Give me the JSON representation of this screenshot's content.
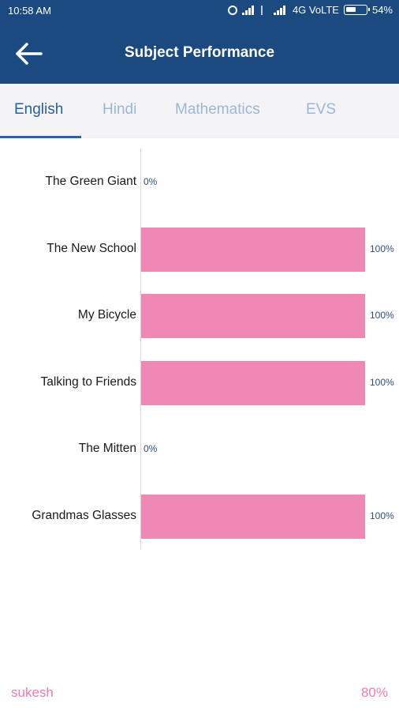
{
  "status_bar": {
    "time": "10:58 AM",
    "network": "4G VoLTE",
    "battery": "54%",
    "battery_level": 0.54
  },
  "app_bar": {
    "title": "Subject Performance",
    "back_icon": "arrow-left-icon"
  },
  "tabs": [
    {
      "label": "English",
      "active": true
    },
    {
      "label": "Hindi",
      "active": false
    },
    {
      "label": "Mathematics",
      "active": false
    },
    {
      "label": "EVS",
      "active": false
    }
  ],
  "colors": {
    "header": "#1b4a80",
    "bar": "#f088b6",
    "active_tab": "#2b5f9e",
    "inactive_tab": "#9db6d8",
    "footer_text": "#f07cb0"
  },
  "chart_data": {
    "type": "bar",
    "orientation": "horizontal",
    "categories": [
      "The Green Giant",
      "The New School",
      "My Bicycle",
      "Talking to Friends",
      "The Mitten",
      "Grandmas Glasses"
    ],
    "values": [
      0,
      100,
      100,
      100,
      0,
      100
    ],
    "value_labels": [
      "0%",
      "100%",
      "100%",
      "100%",
      "0%",
      "100%"
    ],
    "xlim": [
      0,
      100
    ],
    "grid": false
  },
  "footer": {
    "name": "sukesh",
    "score": "80%"
  }
}
